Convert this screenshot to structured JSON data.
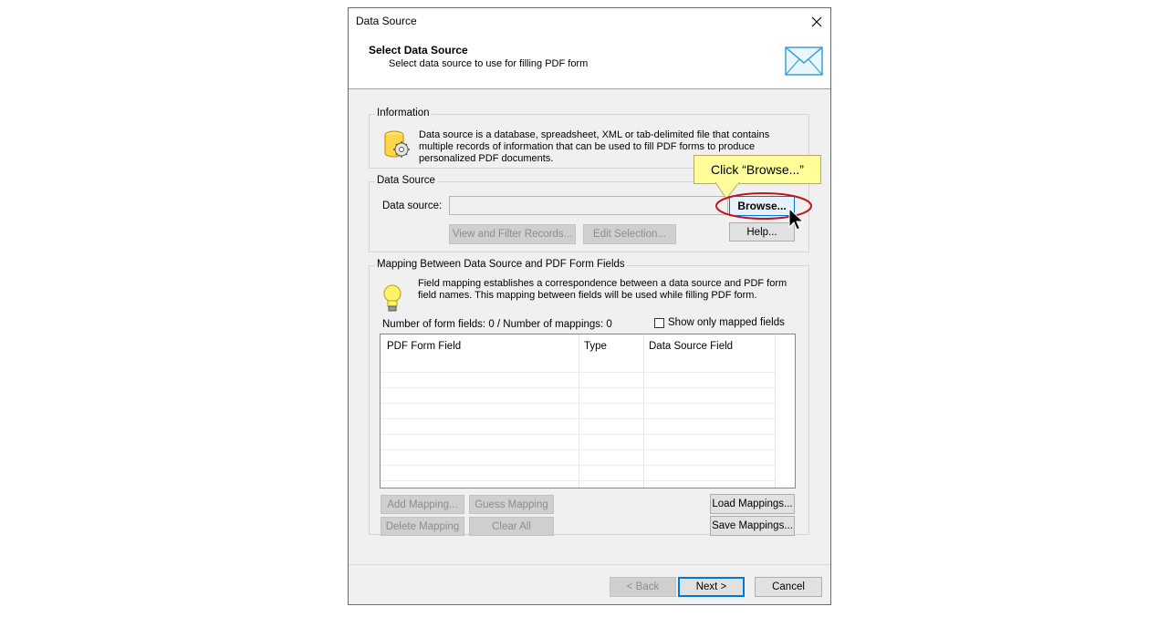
{
  "window": {
    "title": "Data Source"
  },
  "header": {
    "title": "Select Data Source",
    "subtitle": "Select data source to use for filling PDF form"
  },
  "information": {
    "label": "Information",
    "text": "Data source is a database, spreadsheet, XML or tab-delimited file that contains multiple records of information that can be used to fill PDF forms to produce personalized PDF documents."
  },
  "data_source": {
    "group_label": "Data Source",
    "field_label": "Data source:",
    "value": "",
    "browse_label": "Browse...",
    "view_filter_label": "View and Filter Records...",
    "edit_selection_label": "Edit Selection...",
    "help_label": "Help..."
  },
  "mapping": {
    "group_label": "Mapping Between Data Source and PDF Form Fields",
    "text": "Field mapping establishes a correspondence between a data source and PDF form field names. This mapping between fields will be used while filling PDF form.",
    "counts": "Number of form fields: 0 / Number of mappings: 0",
    "show_only_mapped_label": "Show only mapped fields",
    "columns": [
      "PDF Form Field",
      "Type",
      "Data Source Field"
    ],
    "add_mapping_label": "Add Mapping...",
    "guess_mapping_label": "Guess Mapping",
    "load_mappings_label": "Load Mappings...",
    "delete_mapping_label": "Delete Mapping",
    "clear_all_label": "Clear All",
    "save_mappings_label": "Save Mappings..."
  },
  "footer": {
    "back_label": "< Back",
    "next_label": "Next >",
    "cancel_label": "Cancel"
  },
  "callout": {
    "text": "Click “Browse...”"
  },
  "colors": {
    "accent": "#0078d7",
    "highlight_ring": "#c0171e",
    "callout_bg": "#ffff99"
  }
}
